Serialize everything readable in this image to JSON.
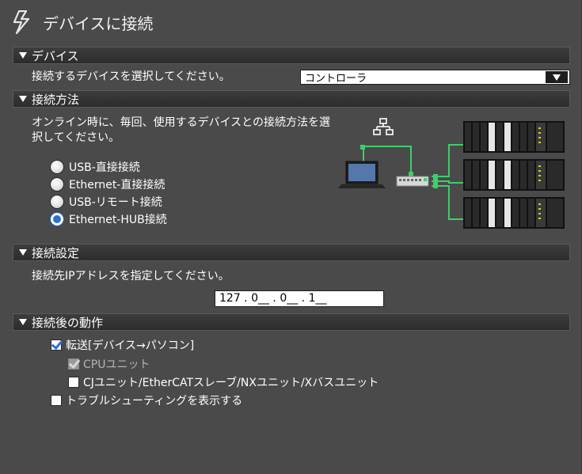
{
  "window": {
    "title": "デバイスに接続"
  },
  "device_section": {
    "header": "デバイス",
    "prompt": "接続するデバイスを選択してください。",
    "selected_device": "コントローラ"
  },
  "method_section": {
    "header": "接続方法",
    "description_line1": "オンライン時に、毎回、使用するデバイスとの接続方法を選",
    "description_line2": "択してください。",
    "options": [
      {
        "label": "USB-直接接続",
        "selected": false
      },
      {
        "label": "Ethernet-直接接続",
        "selected": false
      },
      {
        "label": "USB-リモート接続",
        "selected": false
      },
      {
        "label": "Ethernet-HUB接続",
        "selected": true
      }
    ]
  },
  "settings_section": {
    "header": "接続設定",
    "prompt": "接続先IPアドレスを指定してください。",
    "ip_address": "127 . 0__ . 0__ . 1__"
  },
  "after_section": {
    "header": "接続後の動作",
    "transfer": {
      "label": "転送[デバイス→パソコン]",
      "checked": true
    },
    "cpu_unit": {
      "label": "CPUユニット",
      "checked": true,
      "disabled": true
    },
    "other_units": {
      "label": "CJユニット/EtherCATスレーブ/NXユニット/Xバスユニット",
      "checked": false
    },
    "troubleshoot": {
      "label": "トラブルシューティングを表示する",
      "checked": false
    }
  },
  "colors": {
    "background": "#4a4a4a",
    "header_bg": "#2c2c2c",
    "network_line": "#3ccf6a",
    "radio_selected": "#2d6fd3"
  },
  "icons": [
    "lightning-icon",
    "network-hub-icon",
    "laptop-icon",
    "switch-icon",
    "controller-rack-icon"
  ]
}
